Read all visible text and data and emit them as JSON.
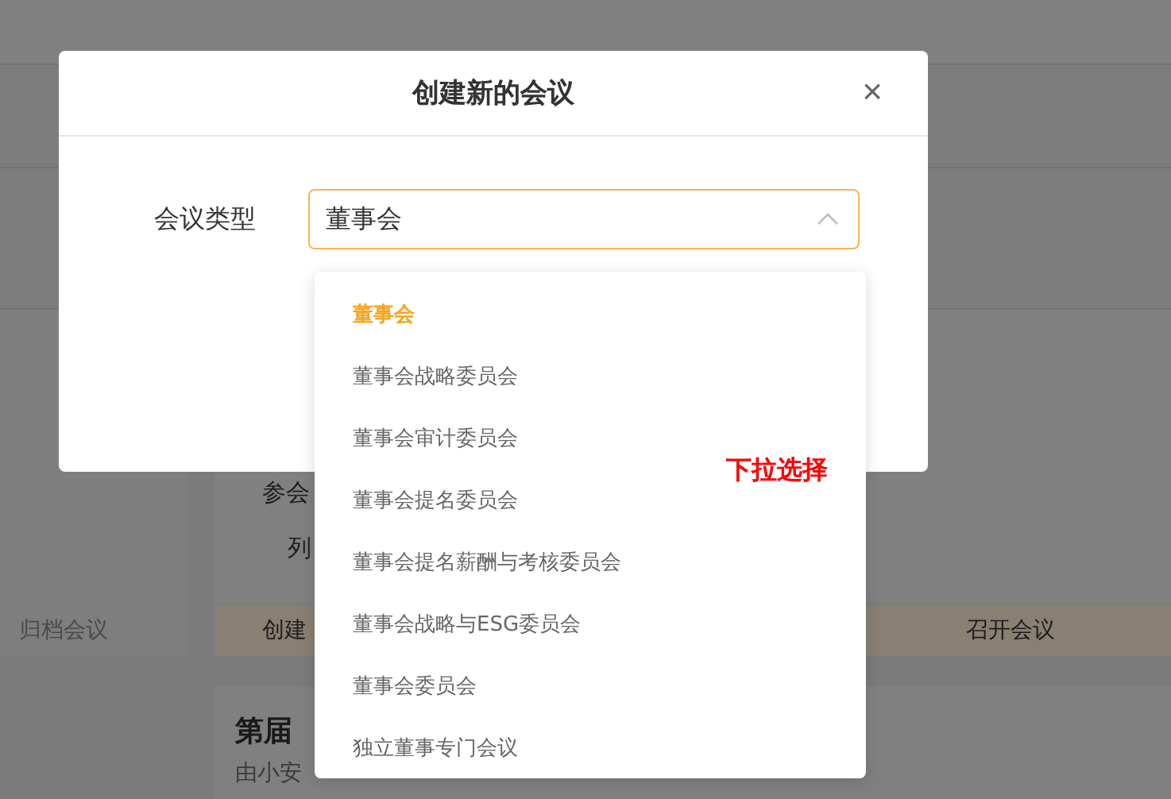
{
  "background": {
    "form_labels": [
      "参会",
      "列"
    ],
    "steps": [
      {
        "label": "归档会议",
        "selected": false
      },
      {
        "label": "创建",
        "selected": true
      },
      {
        "label": "召开会议",
        "selected": true
      }
    ],
    "card": {
      "title": "第届",
      "subtitle": "由小安"
    }
  },
  "dialog": {
    "title": "创建新的会议",
    "close": "×",
    "field": {
      "label": "会议类型",
      "value": "董事会",
      "expanded": true
    }
  },
  "dropdown": {
    "options": [
      {
        "label": "董事会",
        "selected": true
      },
      {
        "label": "董事会战略委员会",
        "selected": false
      },
      {
        "label": "董事会审计委员会",
        "selected": false
      },
      {
        "label": "董事会提名委员会",
        "selected": false
      },
      {
        "label": "董事会提名薪酬与考核委员会",
        "selected": false
      },
      {
        "label": "董事会战略与ESG委员会",
        "selected": false
      },
      {
        "label": "董事会委员会",
        "selected": false
      },
      {
        "label": "独立董事专门会议",
        "selected": false
      }
    ]
  },
  "annotation": "下拉选择"
}
